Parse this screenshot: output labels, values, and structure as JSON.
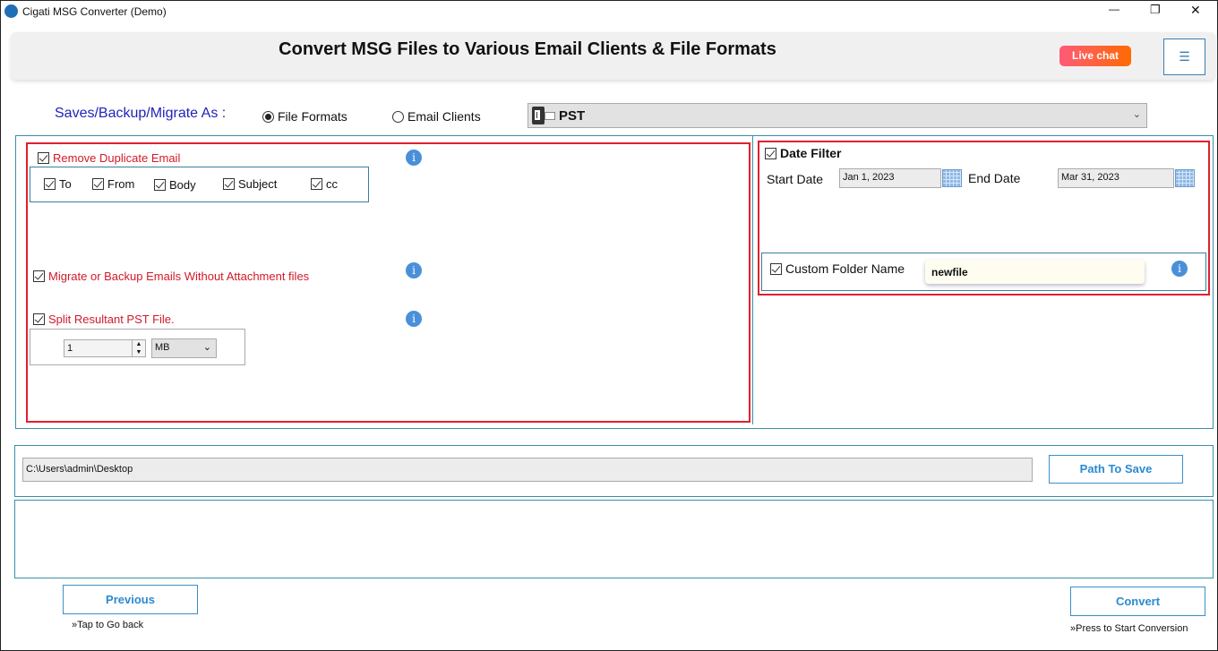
{
  "window": {
    "title": "Cigati MSG Converter (Demo)",
    "minimize": "—",
    "restore": "❐",
    "close": "✕"
  },
  "header": {
    "title": "Convert MSG Files to Various Email Clients & File Formats",
    "live_chat": "Live chat",
    "menu_icon": "☰"
  },
  "save_as": {
    "label": "Saves/Backup/Migrate As :",
    "options": [
      "File Formats",
      "Email Clients"
    ],
    "selected": "File Formats",
    "format_value": "PST",
    "format_icon": "outlook-pst-icon"
  },
  "left_panel": {
    "remove_duplicate": {
      "label": "Remove Duplicate Email",
      "checked": true,
      "fields": [
        {
          "label": "To",
          "checked": true
        },
        {
          "label": "From",
          "checked": true
        },
        {
          "label": "Body",
          "checked": true
        },
        {
          "label": "Subject",
          "checked": true
        },
        {
          "label": "cc",
          "checked": true
        }
      ]
    },
    "without_attachment": {
      "label": "Migrate or Backup Emails Without Attachment files",
      "checked": true
    },
    "split": {
      "label": "Split Resultant PST File.",
      "checked": true,
      "size": "1",
      "unit": "MB"
    },
    "info_glyph": "i"
  },
  "right_panel": {
    "date_filter": {
      "label": "Date Filter",
      "checked": true,
      "start_label": "Start Date",
      "start_value": "Jan 1, 2023",
      "end_label": "End Date",
      "end_value": "Mar 31, 2023"
    },
    "custom_folder": {
      "label": "Custom Folder Name",
      "checked": true,
      "value": "newfile"
    }
  },
  "path": {
    "value": "C:\\Users\\admin\\Desktop",
    "button": "Path To Save"
  },
  "footer": {
    "previous": "Previous",
    "previous_hint": "»Tap to Go back",
    "convert": "Convert",
    "convert_hint": "»Press to Start Conversion"
  },
  "colors": {
    "accent": "#2a8ad0",
    "highlight_red": "#e0202e",
    "label_blue": "#2222bb"
  }
}
